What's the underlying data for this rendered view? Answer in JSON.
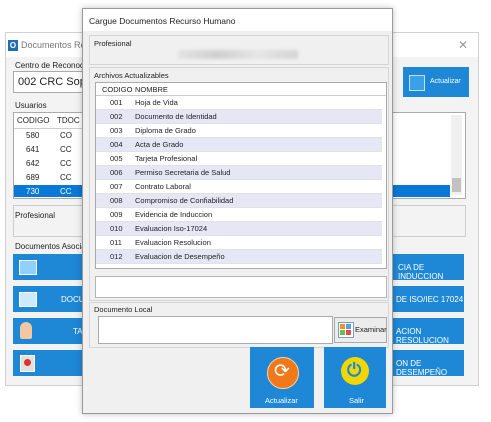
{
  "background_window": {
    "title": "Documentos Recurso",
    "centro_label": "Centro de Reconocim",
    "centro_value": "002 CRC Sop",
    "actualizar_label": "Actualizar",
    "usuarios_label": "Usuarios",
    "usuarios_columns": [
      "CODIGO",
      "TDOC"
    ],
    "usuarios_rows": [
      {
        "codigo": "580",
        "tdoc": "CO"
      },
      {
        "codigo": "641",
        "tdoc": "CC"
      },
      {
        "codigo": "642",
        "tdoc": "CC"
      },
      {
        "codigo": "689",
        "tdoc": "CC"
      },
      {
        "codigo": "730",
        "tdoc": "CC"
      }
    ],
    "profesional_label": "Profesional",
    "documentos_label": "Documentos Asociado",
    "doc_buttons": [
      {
        "left_text": "",
        "right_text": "CIA DE INDUCCION"
      },
      {
        "left_text": "DOCU",
        "right_text": "DE ISO/IEC 17024"
      },
      {
        "left_text": "TA",
        "right_text": "ACION RESOLUCION"
      },
      {
        "left_text": "",
        "right_text": "ON DE DESEMPEÑO"
      }
    ]
  },
  "modal": {
    "title": "Cargue Documentos Recurso Humano",
    "profesional_label": "Profesional",
    "archivos_label": "Archivos Actualizables",
    "columns": [
      "CODIGO",
      "NOMBRE"
    ],
    "rows": [
      {
        "codigo": "001",
        "nombre": "Hoja de Vida"
      },
      {
        "codigo": "002",
        "nombre": "Documento de Identidad"
      },
      {
        "codigo": "003",
        "nombre": "Diploma de Grado"
      },
      {
        "codigo": "004",
        "nombre": "Acta de Grado"
      },
      {
        "codigo": "005",
        "nombre": "Tarjeta Profesional"
      },
      {
        "codigo": "006",
        "nombre": "Permiso Secretaria de Salud"
      },
      {
        "codigo": "007",
        "nombre": "Contrato Laboral"
      },
      {
        "codigo": "008",
        "nombre": "Compromiso de Confiabilidad"
      },
      {
        "codigo": "009",
        "nombre": "Evidencia de Induccion"
      },
      {
        "codigo": "010",
        "nombre": "Evaluacion Iso-17024"
      },
      {
        "codigo": "011",
        "nombre": "Evaluacion Resolucion"
      },
      {
        "codigo": "012",
        "nombre": "Evaluacion de Desempeño"
      }
    ],
    "documento_local_label": "Documento Local",
    "examinar_label": "Examinar",
    "actualizar_label": "Actualizar",
    "salir_label": "Salir"
  },
  "colors": {
    "accent": "#1e88d6",
    "selected_row": "#0a78d7",
    "alt_row": "#e6e6f5",
    "salir_icon": "#f2d600",
    "actualizar_icon": "#f07a1a"
  }
}
